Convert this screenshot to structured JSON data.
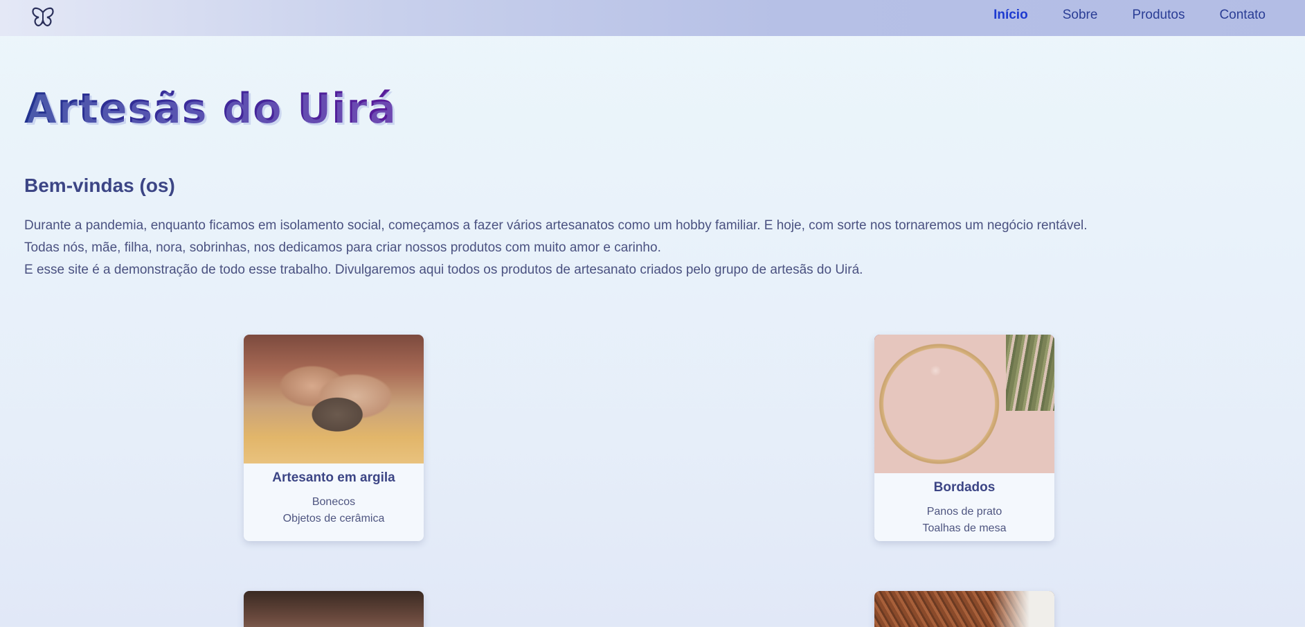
{
  "header": {
    "logo": "butterfly-icon",
    "nav": [
      "Início",
      "Sobre",
      "Produtos",
      "Contato"
    ],
    "active_nav": "Início"
  },
  "main": {
    "title": "Artesãs do Uirá",
    "welcome": "Bem-vindas (os)",
    "intro": [
      "Durante a pandemia, enquanto ficamos em isolamento social, começamos a fazer vários artesanatos como um hobby familiar. E hoje, com sorte nos tornaremos um negócio rentável.",
      "Todas nós, mãe, filha, nora, sobrinhas, nos dedicamos para criar nossos produtos com muito amor e carinho.",
      "E esse site é a demonstração de todo esse trabalho. Divulgaremos aqui todos os produtos de artesanato criados pelo grupo de artesãs do Uirá."
    ]
  },
  "cards": [
    {
      "title": "Artesanto em argila",
      "items": [
        "Bonecos",
        "Objetos de cerâmica"
      ],
      "image": "clay-hands-photo"
    },
    {
      "title": "Bordados",
      "items": [
        "Panos de prato",
        "Toalhas de mesa"
      ],
      "image": "embroidery-hoop-photo"
    },
    {
      "title": "",
      "items": [],
      "image": "craft-photo"
    },
    {
      "title": "",
      "items": [],
      "image": "knitting-photo"
    }
  ],
  "colors": {
    "nav_active": "#1d3ad0",
    "nav": "#2a3d95",
    "title_start": "#22338f",
    "title_end": "#5a1a9a",
    "text": "#4a5180"
  }
}
